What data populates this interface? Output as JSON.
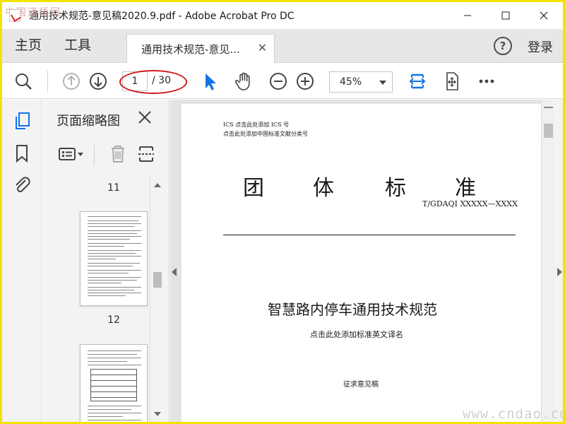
{
  "window": {
    "title": "通用技术规范-意见稿2020.9.pdf - Adobe Acrobat Pro DC",
    "watermark_top": "中国道桥网",
    "watermark_bottom": "www.cndao.com",
    "highlight_color": "#d21a1a",
    "frame_color": "#f2e400"
  },
  "tabbar": {
    "home": "主页",
    "tools": "工具",
    "doc_tab": "通用技术规范-意见...",
    "login": "登录"
  },
  "toolbar": {
    "current_page": "1",
    "total_pages": "/ 30",
    "zoom": "45%",
    "accent_color": "#1473e6"
  },
  "panel": {
    "title": "页面缩略图",
    "pages": [
      "11",
      "12"
    ]
  },
  "document": {
    "ics": "ICS 点击此处添加 ICS 号",
    "classification": "点击此处添加中国标准文献分类号",
    "std_chars": [
      "团",
      "体",
      "标",
      "准"
    ],
    "std_number": "T/GDAQI XXXXX—XXXX",
    "main_title": "智慧路内停车通用技术规范",
    "english_title": "点击此处添加标准英文译名",
    "status": "征求意见稿"
  }
}
